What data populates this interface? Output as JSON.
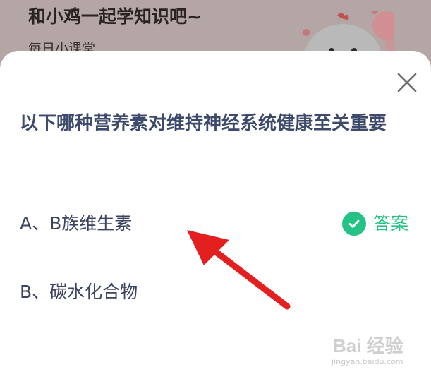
{
  "banner": {
    "title": "和小鸡一起学知识吧~",
    "subtitle": "每日小课堂"
  },
  "dialog": {
    "question": "以下哪种营养素对维持神经系统健康至关重要",
    "options": [
      {
        "label": "A、B族维生素"
      },
      {
        "label": "B、碳水化合物"
      }
    ],
    "answer_label": "答案",
    "accent_color": "#25c285",
    "question_color": "#3d4a6b"
  },
  "watermark": {
    "logo_text": "Bai 经验",
    "url": "jingyan.baidu.com"
  },
  "icons": {
    "close": "close-icon",
    "check": "check-circle-icon",
    "arrow": "red-arrow-icon",
    "mascot": "chick-icon"
  }
}
